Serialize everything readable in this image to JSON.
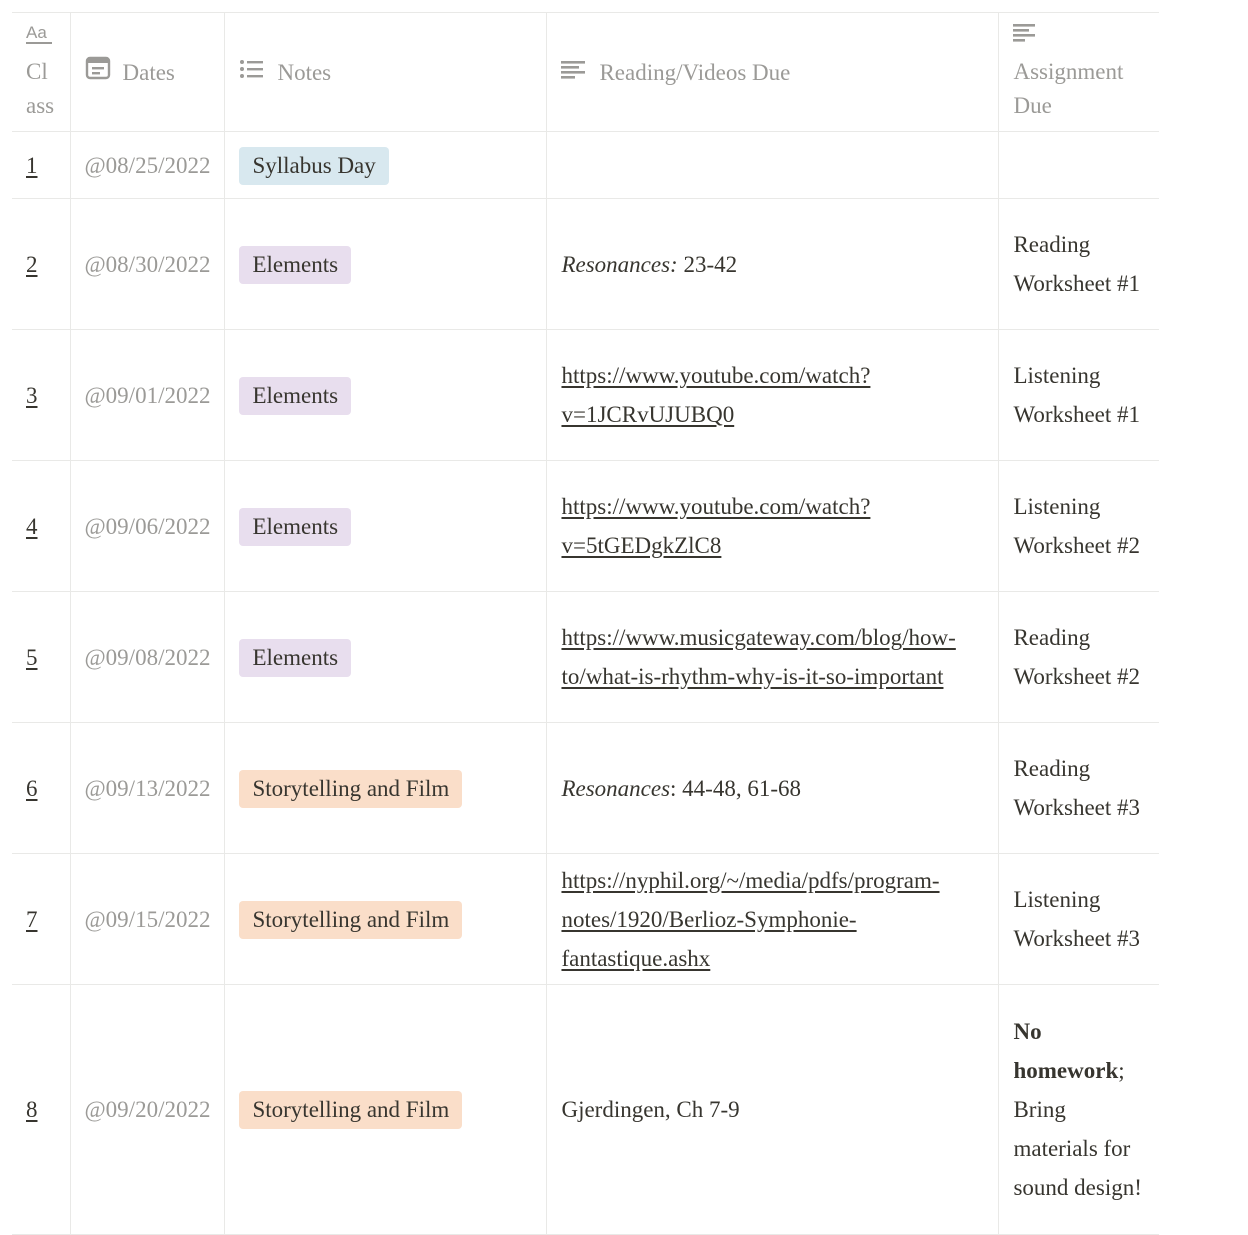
{
  "columns": {
    "class": "Class",
    "dates": "Dates",
    "notes": "Notes",
    "reading": "Reading/Videos Due",
    "assignment": "Assignment Due"
  },
  "colors": {
    "tag_syllabus": "#d8e8ef",
    "tag_elements": "#e8deee",
    "tag_story": "#fadec9",
    "text": "#37352f",
    "muted": "#9b9a97"
  },
  "rows": [
    {
      "class": "1",
      "date": "@08/25/2022",
      "note": "Syllabus Day",
      "reading": "",
      "assignment": ""
    },
    {
      "class": "2",
      "date": "@08/30/2022",
      "note": "Elements",
      "reading_italic": "Resonances:",
      "reading": " 23-42",
      "assignment": "Reading Worksheet #1"
    },
    {
      "class": "3",
      "date": "@09/01/2022",
      "note": "Elements",
      "reading": "https://www.youtube.com/watch?v=1JCRvUJUBQ0",
      "assignment": "Listening Worksheet #1"
    },
    {
      "class": "4",
      "date": "@09/06/2022",
      "note": "Elements",
      "reading": "https://www.youtube.com/watch?v=5tGEDgkZlC8",
      "assignment": "Listening Worksheet #2"
    },
    {
      "class": "5",
      "date": "@09/08/2022",
      "note": "Elements",
      "reading": "https://www.musicgateway.com/blog/how-to/what-is-rhythm-why-is-it-so-important",
      "assignment": "Reading Worksheet #2"
    },
    {
      "class": "6",
      "date": "@09/13/2022",
      "note": "Storytelling and Film",
      "reading_italic": "Resonances",
      "reading": ": 44-48, 61-68",
      "assignment": "Reading Worksheet #3"
    },
    {
      "class": "7",
      "date": "@09/15/2022",
      "note": "Storytelling and Film",
      "reading": "https://nyphil.org/~/media/pdfs/program-notes/1920/Berlioz-Symphonie-fantastique.ashx",
      "assignment": "Listening Worksheet #3"
    },
    {
      "class": "8",
      "date": "@09/20/2022",
      "note": "Storytelling and Film",
      "reading": "Gjerdingen, Ch 7-9",
      "assignment_bold": "No homework",
      "assignment": "; Bring materials for sound design!"
    }
  ]
}
